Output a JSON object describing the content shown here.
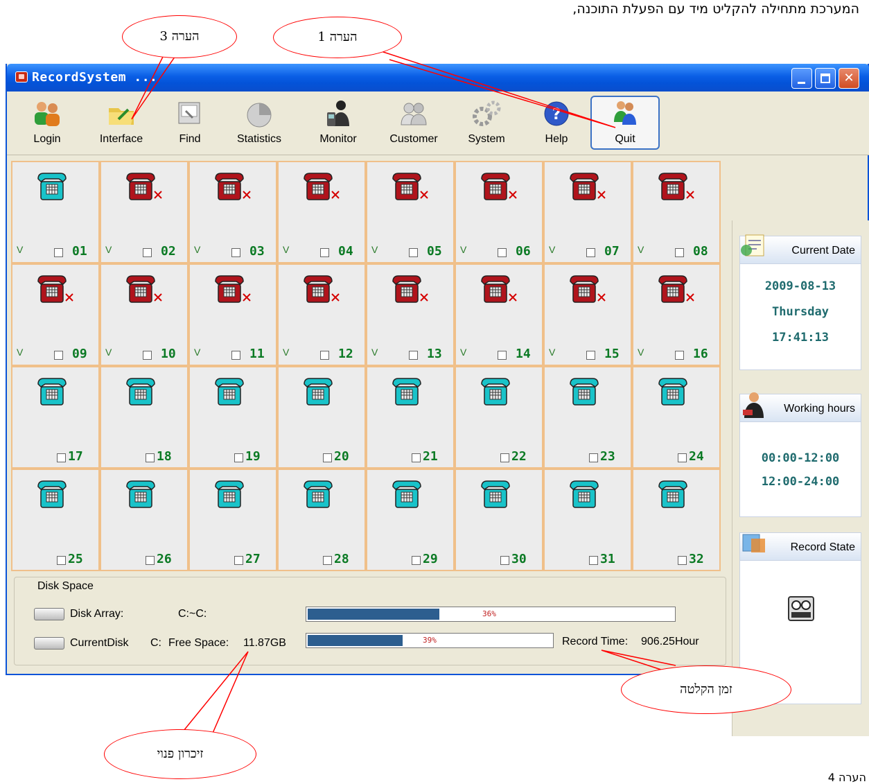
{
  "document": {
    "top_note": "המערכת מתחילה להקליט מיד עם הפעלת התוכנה,",
    "bottom_note": "הערה 4"
  },
  "window": {
    "title": "RecordSystem ...",
    "controls": [
      "minimize",
      "maximize",
      "close"
    ]
  },
  "toolbar": {
    "items": [
      {
        "label": "Login",
        "icon": "users-icon"
      },
      {
        "label": "Interface",
        "icon": "folder-icon"
      },
      {
        "label": "Find",
        "icon": "find-icon"
      },
      {
        "label": "Statistics",
        "icon": "pie-chart-icon"
      },
      {
        "label": "Monitor",
        "icon": "phone-person-icon"
      },
      {
        "label": "Customer",
        "icon": "customers-icon"
      },
      {
        "label": "System",
        "icon": "gears-icon"
      },
      {
        "label": "Help",
        "icon": "help-icon"
      },
      {
        "label": "Quit",
        "icon": "quit-icon"
      }
    ]
  },
  "channels": [
    {
      "num": "01",
      "state": "idle",
      "v": "V"
    },
    {
      "num": "02",
      "state": "off",
      "v": "V"
    },
    {
      "num": "03",
      "state": "off",
      "v": "V"
    },
    {
      "num": "04",
      "state": "off",
      "v": "V"
    },
    {
      "num": "05",
      "state": "off",
      "v": "V"
    },
    {
      "num": "06",
      "state": "off",
      "v": "V"
    },
    {
      "num": "07",
      "state": "off",
      "v": "V"
    },
    {
      "num": "08",
      "state": "off",
      "v": "V"
    },
    {
      "num": "09",
      "state": "off",
      "v": "V"
    },
    {
      "num": "10",
      "state": "off",
      "v": "V"
    },
    {
      "num": "11",
      "state": "off",
      "v": "V"
    },
    {
      "num": "12",
      "state": "off",
      "v": "V"
    },
    {
      "num": "13",
      "state": "off",
      "v": "V"
    },
    {
      "num": "14",
      "state": "off",
      "v": "V"
    },
    {
      "num": "15",
      "state": "off",
      "v": "V"
    },
    {
      "num": "16",
      "state": "off",
      "v": "V"
    },
    {
      "num": "17",
      "state": "idle",
      "v": ""
    },
    {
      "num": "18",
      "state": "idle",
      "v": ""
    },
    {
      "num": "19",
      "state": "idle",
      "v": ""
    },
    {
      "num": "20",
      "state": "idle",
      "v": ""
    },
    {
      "num": "21",
      "state": "idle",
      "v": ""
    },
    {
      "num": "22",
      "state": "idle",
      "v": ""
    },
    {
      "num": "23",
      "state": "idle",
      "v": ""
    },
    {
      "num": "24",
      "state": "idle",
      "v": ""
    },
    {
      "num": "25",
      "state": "idle",
      "v": ""
    },
    {
      "num": "26",
      "state": "idle",
      "v": ""
    },
    {
      "num": "27",
      "state": "idle",
      "v": ""
    },
    {
      "num": "28",
      "state": "idle",
      "v": ""
    },
    {
      "num": "29",
      "state": "idle",
      "v": ""
    },
    {
      "num": "30",
      "state": "idle",
      "v": ""
    },
    {
      "num": "31",
      "state": "idle",
      "v": ""
    },
    {
      "num": "32",
      "state": "idle",
      "v": ""
    }
  ],
  "side": {
    "current_date": {
      "header": "Current Date",
      "date": "2009-08-13",
      "weekday": "Thursday",
      "time": "17:41:13"
    },
    "working_hours": {
      "header": "Working hours",
      "ranges": [
        "00:00-12:00",
        "12:00-24:00"
      ]
    },
    "record_state": {
      "header": "Record State",
      "icon": "tape-recorder-icon"
    }
  },
  "disk": {
    "legend": "Disk Space",
    "array": {
      "label": "Disk Array:",
      "drives": "C:~C:",
      "percent": 36,
      "percent_text": "36%"
    },
    "current": {
      "label": "CurrentDisk",
      "drive": "C:",
      "free_label": "Free Space:",
      "free_value": "11.87GB",
      "percent": 39,
      "percent_text": "39%"
    },
    "record_time": {
      "label": "Record Time:",
      "value": "906.25Hour"
    }
  },
  "annotations": {
    "note3": "הערה 3",
    "note1": "הערה 1",
    "record_time": "זמן  הקלטה",
    "free_memory": "זיכרון פנוי"
  },
  "colors": {
    "titlebar": "#0453d8",
    "channel_number": "#0b7a24",
    "cell_border": "#f0c08a",
    "progress_fill": "#2d5e8f",
    "annotation_stroke": "#ff0000",
    "phone_idle": "#19c3c9",
    "phone_off": "#b0141c"
  }
}
